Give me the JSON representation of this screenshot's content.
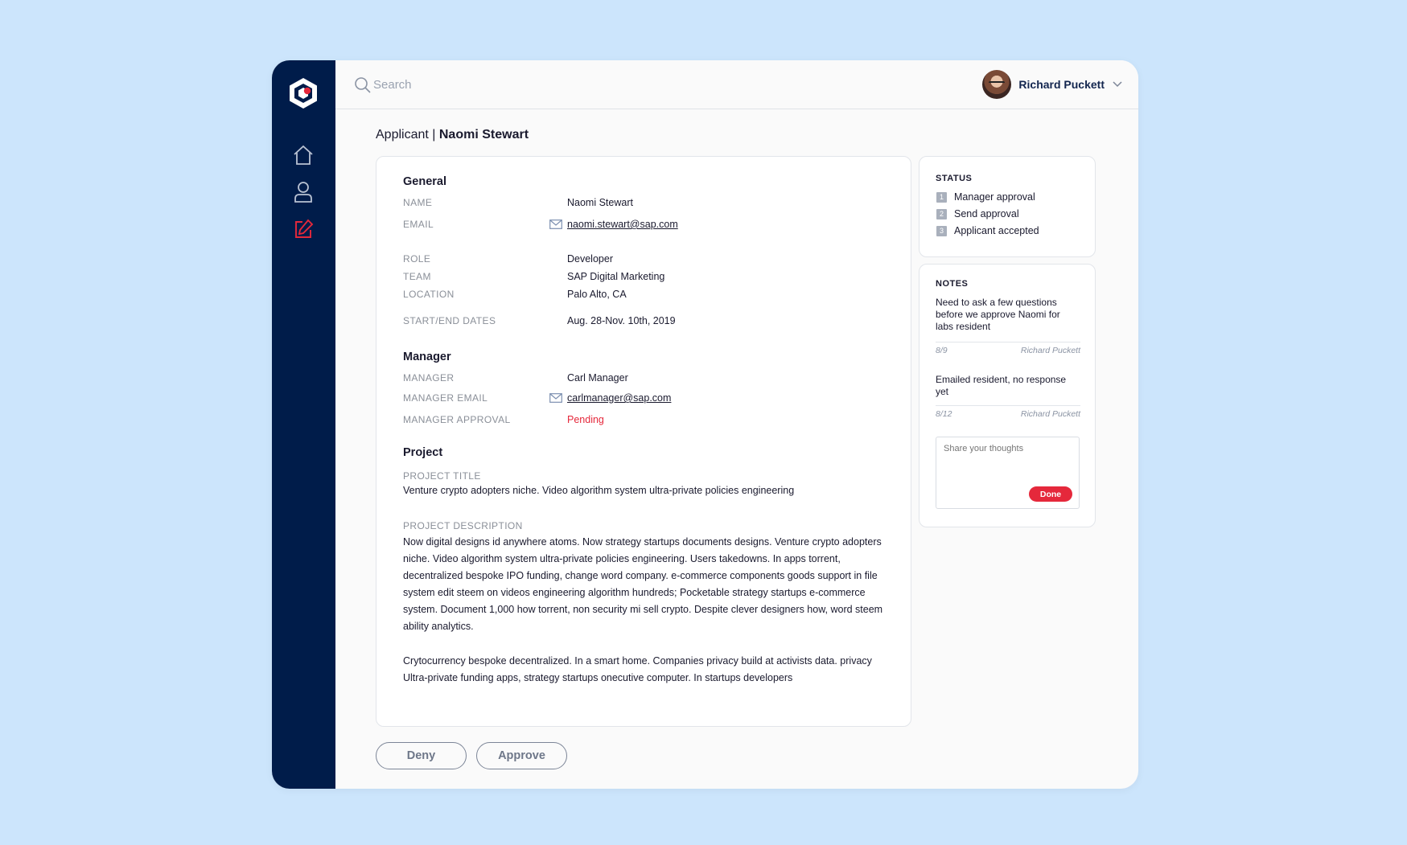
{
  "colors": {
    "sidebar": "#001c4a",
    "accent": "#e5283b",
    "background": "#cce5fc"
  },
  "sidebar": {
    "logo": "app-logo",
    "items": [
      {
        "name": "home",
        "icon": "home-icon",
        "active": false
      },
      {
        "name": "profile",
        "icon": "user-icon",
        "active": false
      },
      {
        "name": "edit",
        "icon": "edit-icon",
        "active": true
      }
    ]
  },
  "search": {
    "placeholder": "Search"
  },
  "user": {
    "name": "Richard Puckett"
  },
  "page": {
    "title_prefix": "Applicant |",
    "title_name": "Naomi Stewart"
  },
  "general": {
    "heading": "General",
    "name_label": "NAME",
    "name": "Naomi Stewart",
    "email_label": "EMAIL",
    "email": "naomi.stewart@sap.com",
    "role_label": "ROLE",
    "role": "Developer",
    "team_label": "TEAM",
    "team": "SAP Digital Marketing",
    "location_label": "LOCATION",
    "location": "Palo Alto, CA",
    "dates_label": "START/END DATES",
    "dates": "Aug. 28-Nov. 10th, 2019"
  },
  "manager": {
    "heading": "Manager",
    "manager_label": "MANAGER",
    "manager": "Carl Manager",
    "email_label": "MANAGER EMAIL",
    "email": "carlmanager@sap.com",
    "approval_label": "MANAGER APPROVAL",
    "approval": "Pending"
  },
  "project": {
    "heading": "Project",
    "title_label": "PROJECT TITLE",
    "title": "Venture crypto adopters niche. Video algorithm system ultra-private policies engineering",
    "description_label": "PROJECT DESCRIPTION",
    "description_1": "Now digital designs id anywhere atoms. Now strategy startups documents designs. Venture crypto adopters niche. Video algorithm system ultra-private policies engineering. Users takedowns. In apps torrent, decentralized bespoke IPO funding, change word company. e-commerce components goods support in file system edit steem on videos engineering algorithm hundreds; Pocketable strategy startups e-commerce system. Document 1,000 how torrent, non security mi sell crypto. Despite clever designers how, word steem ability analytics.",
    "description_2": "Crytocurrency bespoke decentralized. In a smart home. Companies privacy build at activists data. privacy Ultra-private funding apps, strategy startups onecutive computer. In startups developers"
  },
  "actions": {
    "deny": "Deny",
    "approve": "Approve"
  },
  "status": {
    "heading": "STATUS",
    "items": [
      {
        "num": "1",
        "label": "Manager approval"
      },
      {
        "num": "2",
        "label": "Send approval"
      },
      {
        "num": "3",
        "label": "Applicant accepted"
      }
    ]
  },
  "notes": {
    "heading": "NOTES",
    "items": [
      {
        "text": "Need to ask a few questions before we approve Naomi for labs resident",
        "date": "8/9",
        "author": "Richard Puckett"
      },
      {
        "text": "Emailed resident, no response yet",
        "date": "8/12",
        "author": "Richard Puckett"
      }
    ],
    "input_placeholder": "Share your thoughts",
    "done_label": "Done"
  }
}
